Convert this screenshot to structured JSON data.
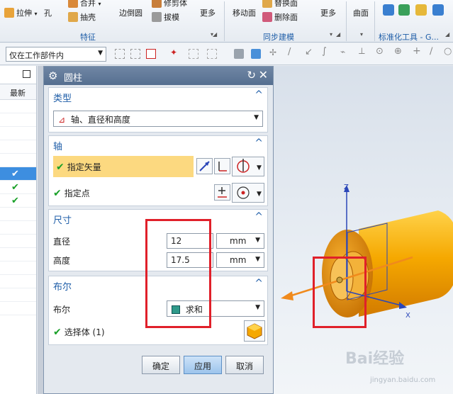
{
  "ribbon": {
    "items": [
      {
        "label": "拉伸"
      },
      {
        "label": "孔"
      },
      {
        "label": "合并"
      },
      {
        "label": "抽壳"
      },
      {
        "label": "边倒圆"
      },
      {
        "label": "修剪体"
      },
      {
        "label": "拔模"
      },
      {
        "label": "更多"
      },
      {
        "label": "移动面"
      },
      {
        "label": "替换面"
      },
      {
        "label": "删除面"
      },
      {
        "label": "更多"
      },
      {
        "label": "曲面"
      }
    ],
    "groups": {
      "feature": "特征",
      "sync": "同步建模",
      "standard": "标准化工具 - G..."
    }
  },
  "filter": {
    "value": "仅在工作部件内"
  },
  "navigator": {
    "column": "最新"
  },
  "dialog": {
    "title": "圆柱",
    "type_section": {
      "header": "类型",
      "value": "轴、直径和高度"
    },
    "axis_section": {
      "header": "轴",
      "vector_label": "指定矢量",
      "point_label": "指定点"
    },
    "dimension_section": {
      "header": "尺寸",
      "diameter_label": "直径",
      "diameter_value": "12",
      "diameter_unit": "mm",
      "height_label": "高度",
      "height_value": "17.5",
      "height_unit": "mm"
    },
    "boolean_section": {
      "header": "布尔",
      "boolean_label": "布尔",
      "boolean_value": "求和",
      "select_body_label": "选择体 (1)"
    },
    "buttons": {
      "ok": "确定",
      "apply": "应用",
      "cancel": "取消"
    }
  },
  "graphics": {
    "axis_z": "Z",
    "axis_x": "X"
  },
  "watermark": {
    "brand": "Bai经验",
    "url": "jingyan.baidu.com"
  }
}
